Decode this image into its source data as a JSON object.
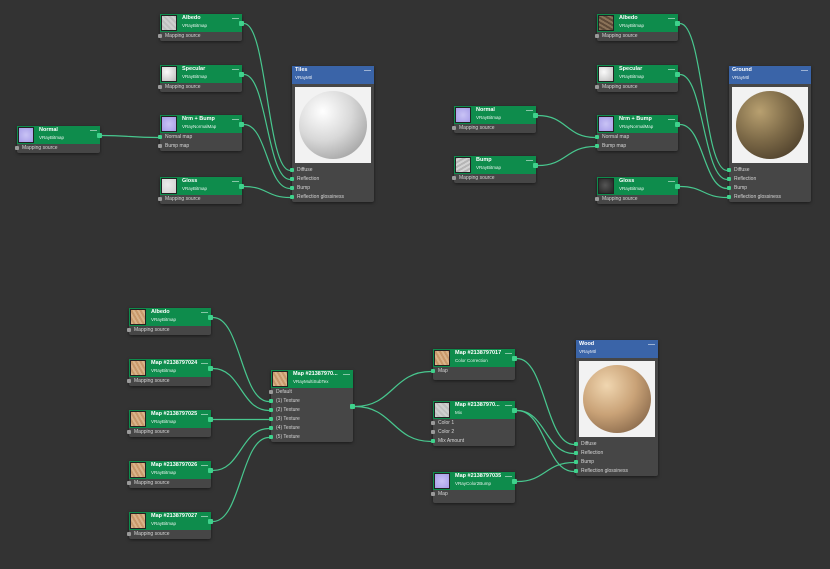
{
  "colors": {
    "texture_header": "#0e8c4c",
    "material_header": "#3a64a8",
    "wire": "#48c88f",
    "canvas": "#333333"
  },
  "nodes": [
    {
      "id": "t_albedo",
      "title": "Albedo",
      "sub": "VRayBitmap",
      "thumb": "gray",
      "inputs": [
        "Mapping source"
      ]
    },
    {
      "id": "t_specular",
      "title": "Specular",
      "sub": "VRayBitmap",
      "thumb": "white",
      "inputs": [
        "Mapping source"
      ]
    },
    {
      "id": "t_nrm",
      "title": "Nrm + Bump",
      "sub": "VRayNormalMap",
      "thumb": "normal",
      "inputs": [
        "Normal map",
        "Bump map"
      ]
    },
    {
      "id": "t_normal",
      "title": "Normal",
      "sub": "VRayBitmap",
      "thumb": "normal",
      "inputs": [
        "Mapping source"
      ]
    },
    {
      "id": "t_gloss",
      "title": "Gloss",
      "sub": "VRayBitmap",
      "thumb": "gloss",
      "inputs": [
        "Mapping source"
      ]
    },
    {
      "id": "tiles",
      "title": "Tiles",
      "sub": "VRayMtl",
      "material": true,
      "sphere": "tiles",
      "inputs": [
        "Diffuse",
        "Reflection",
        "Bump",
        "Reflection glossiness"
      ]
    },
    {
      "id": "g_albedo",
      "title": "Albedo",
      "sub": "VRayBitmap",
      "thumb": "rock",
      "inputs": [
        "Mapping source"
      ]
    },
    {
      "id": "g_specular",
      "title": "Specular",
      "sub": "VRayBitmap",
      "thumb": "white",
      "inputs": [
        "Mapping source"
      ]
    },
    {
      "id": "g_normal",
      "title": "Normal",
      "sub": "VRayBitmap",
      "thumb": "normal",
      "inputs": [
        "Mapping source"
      ]
    },
    {
      "id": "g_nrm",
      "title": "Nrm + Bump",
      "sub": "VRayNormalMap",
      "thumb": "normal",
      "inputs": [
        "Normal map",
        "Bump map"
      ]
    },
    {
      "id": "g_bump",
      "title": "Bump",
      "sub": "VRayBitmap",
      "thumb": "bump",
      "inputs": [
        "Mapping source"
      ]
    },
    {
      "id": "g_gloss",
      "title": "Gloss",
      "sub": "VRayBitmap",
      "thumb": "dark",
      "inputs": [
        "Mapping source"
      ]
    },
    {
      "id": "ground",
      "title": "Ground",
      "sub": "VRayMtl",
      "material": true,
      "sphere": "ground",
      "inputs": [
        "Diffuse",
        "Reflection",
        "Bump",
        "Reflection glossiness"
      ]
    },
    {
      "id": "w_albedo",
      "title": "Albedo",
      "sub": "VRayBitmap",
      "thumb": "wood",
      "inputs": [
        "Mapping source"
      ]
    },
    {
      "id": "w_024",
      "title": "Map #2138797024",
      "sub": "VRayBitmap",
      "thumb": "wood",
      "inputs": [
        "Mapping source"
      ]
    },
    {
      "id": "w_025",
      "title": "Map #2138797025",
      "sub": "VRayBitmap",
      "thumb": "wood",
      "inputs": [
        "Mapping source"
      ]
    },
    {
      "id": "w_026",
      "title": "Map #2138797026",
      "sub": "VRayBitmap",
      "thumb": "wood",
      "inputs": [
        "Mapping source"
      ]
    },
    {
      "id": "w_027",
      "title": "Map #2138797027",
      "sub": "VRayBitmap",
      "thumb": "wood",
      "inputs": [
        "Mapping source"
      ]
    },
    {
      "id": "w_multi",
      "title": "Map #2138797​0...",
      "sub": "VRayMultiSubTex",
      "thumb": "wood",
      "inputs": [
        "Default",
        "(1) Texture",
        "(2) Texture",
        "(3) Texture",
        "(4) Texture",
        "(5) Texture"
      ]
    },
    {
      "id": "w_017",
      "title": "Map #2138797017",
      "sub": "Color Correction",
      "thumb": "wood",
      "inputs": [
        "Map"
      ]
    },
    {
      "id": "w_mix",
      "title": "Map #2138797​0...",
      "sub": "Mix",
      "thumb": "gray",
      "inputs": [
        "Color 1",
        "Color 2",
        "Mix Amount"
      ]
    },
    {
      "id": "w_035",
      "title": "Map #2138797035",
      "sub": "VRayColor2Bump",
      "thumb": "normal",
      "inputs": [
        "Map"
      ]
    },
    {
      "id": "wood",
      "title": "Wood",
      "sub": "VRayMtl",
      "material": true,
      "sphere": "wood",
      "inputs": [
        "Diffuse",
        "Reflection",
        "Bump",
        "Reflection glossiness"
      ]
    }
  ],
  "collapse_symbol": "—"
}
